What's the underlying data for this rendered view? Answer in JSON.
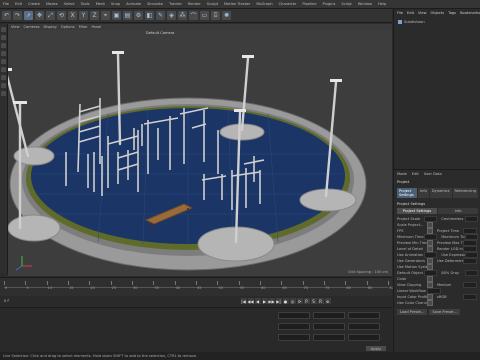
{
  "menu": [
    "File",
    "Edit",
    "Create",
    "Modes",
    "Select",
    "Tools",
    "Mesh",
    "Snap",
    "Animate",
    "Simulate",
    "Tracker",
    "Render",
    "Sculpt",
    "Motion Tracker",
    "MoGraph",
    "Character",
    "Pipeline",
    "Plugins",
    "Script",
    "Window",
    "Help"
  ],
  "viewport": {
    "menu": [
      "View",
      "Cameras",
      "Display",
      "Options",
      "Filter",
      "Panel"
    ],
    "camera_label": "Default Camera",
    "grid_spacing": "Grid Spacing : 100 cm"
  },
  "right_panel": {
    "tabs": [
      "File",
      "Edit",
      "View",
      "Objects",
      "Tags",
      "Bookmarks"
    ],
    "objects": [
      "Subdivision"
    ],
    "attributes": {
      "tabs": [
        "Mode",
        "Edit",
        "User Data"
      ],
      "title": "Project",
      "page_tabs": [
        "Project Settings",
        "Info",
        "Dynamics",
        "Referencing"
      ],
      "section": "Project Settings",
      "subtabs": [
        "Project Settings",
        "Info"
      ],
      "rows": [
        {
          "left": "Project Scale",
          "right": "Centimeters"
        },
        {
          "left": "Scale Project...",
          "right": ""
        },
        {
          "left": "FPS",
          "right": "Project Time"
        },
        {
          "left": "Minimum Time",
          "right": "Maximum Time"
        },
        {
          "left": "Preview Min Time",
          "right": "Preview Max Time"
        },
        {
          "left": "Level of Detail",
          "right": "Render LOD in Editor"
        },
        {
          "left": "Use Animation",
          "right": "Use Expression"
        },
        {
          "left": "Use Generators",
          "right": "Use Deformers"
        },
        {
          "left": "Use Motion System",
          "right": ""
        },
        {
          "left": "Default Object Color",
          "right": "80% Gray"
        },
        {
          "left": "Color",
          "right": ""
        },
        {
          "left": "View Clipping",
          "right": "Medium"
        },
        {
          "left": "Linear Workflow",
          "right": ""
        },
        {
          "left": "Input Color Profile",
          "right": "sRGB"
        },
        {
          "left": "Use Color Channel for Node Material",
          "right": ""
        }
      ],
      "buttons": [
        "Load Preset...",
        "Save Preset..."
      ]
    }
  },
  "timeline": {
    "ticks": [
      "0",
      "5",
      "10",
      "15",
      "20",
      "25",
      "30",
      "35",
      "40",
      "45",
      "50",
      "55",
      "60",
      "65",
      "70",
      "75",
      "80",
      "85",
      "90"
    ],
    "frame": "0 F"
  },
  "transport": {
    "icons": [
      "|◀",
      "◀◀",
      "◀",
      "▶",
      "▶▶",
      "▶|",
      "●",
      "◎",
      "⟳",
      "P",
      "S",
      "R",
      "⊕"
    ]
  },
  "coordinates": {
    "apply_label": "Apply"
  },
  "status": {
    "text": "Live Selection: Click and drag to select elements. Hold down SHIFT to add to the selection, CTRL to remove."
  }
}
